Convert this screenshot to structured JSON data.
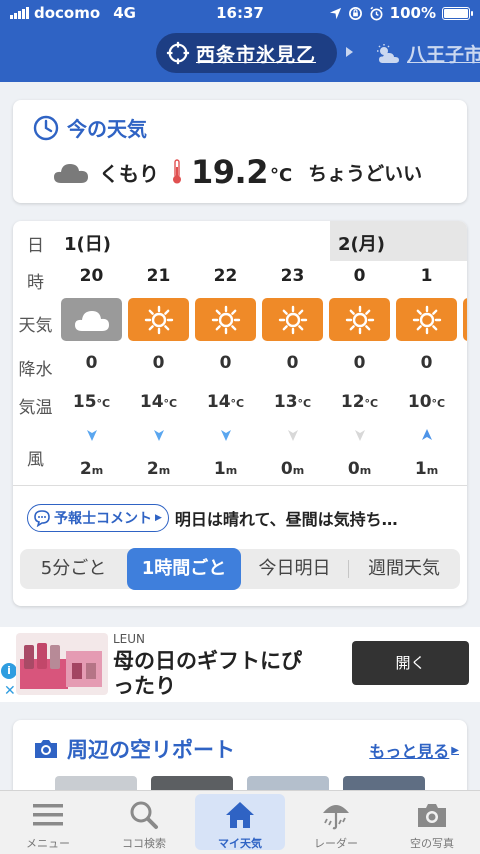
{
  "status": {
    "carrier": "docomo",
    "network": "4G",
    "time": "16:37",
    "battery": "100%"
  },
  "header": {
    "location": "西条市氷見乙",
    "next_location": "八王子市"
  },
  "now": {
    "title": "今の天気",
    "condition": "くもり",
    "temp": "19.2",
    "unit": "°C",
    "feel": "ちょうどいい"
  },
  "forecast": {
    "labels": {
      "day": "日",
      "hour": "時",
      "weather": "天気",
      "precip": "降水",
      "temp": "気温",
      "wind": "風"
    },
    "day_a": "1(日)",
    "day_b": "2(月)",
    "hours": [
      {
        "hour": "20",
        "weather": "cloudy",
        "precip": "0",
        "temp": "15",
        "wind_speed": "2",
        "wind_dir": "north"
      },
      {
        "hour": "21",
        "weather": "sunny",
        "precip": "0",
        "temp": "14",
        "wind_speed": "2",
        "wind_dir": "north"
      },
      {
        "hour": "22",
        "weather": "sunny",
        "precip": "0",
        "temp": "14",
        "wind_speed": "1",
        "wind_dir": "north"
      },
      {
        "hour": "23",
        "weather": "sunny",
        "precip": "0",
        "temp": "13",
        "wind_speed": "0",
        "wind_dir": "calm"
      },
      {
        "hour": "0",
        "weather": "sunny",
        "precip": "0",
        "temp": "12",
        "wind_speed": "0",
        "wind_dir": "calm"
      },
      {
        "hour": "1",
        "weather": "sunny",
        "precip": "0",
        "temp": "10",
        "wind_speed": "1",
        "wind_dir": "south"
      }
    ],
    "temp_unit": "°C",
    "wind_unit": "m",
    "comment_label": "予報士コメント",
    "comment_text": "明日は晴れて、昼間は気持ち…",
    "tabs": [
      "5分ごと",
      "1時間ごと",
      "今日明日",
      "週間天気"
    ],
    "active_tab": "1時間ごと"
  },
  "ad": {
    "brand": "LEUN",
    "text": "母の日のギフトにぴったり",
    "button": "開く"
  },
  "reports": {
    "title": "周辺の空リポート",
    "more": "もっと見る"
  },
  "nav": [
    {
      "label": "メニュー",
      "icon": "menu-icon"
    },
    {
      "label": "ココ検索",
      "icon": "search-icon"
    },
    {
      "label": "マイ天気",
      "icon": "home-icon",
      "active": true
    },
    {
      "label": "レーダー",
      "icon": "radar-icon"
    },
    {
      "label": "空の写真",
      "icon": "camera-icon"
    }
  ],
  "colors": {
    "brand": "#2f63c4",
    "sunny": "#ef8a28",
    "cloudy": "#9a9a9a",
    "wind_blue": "#5aa6ef"
  }
}
